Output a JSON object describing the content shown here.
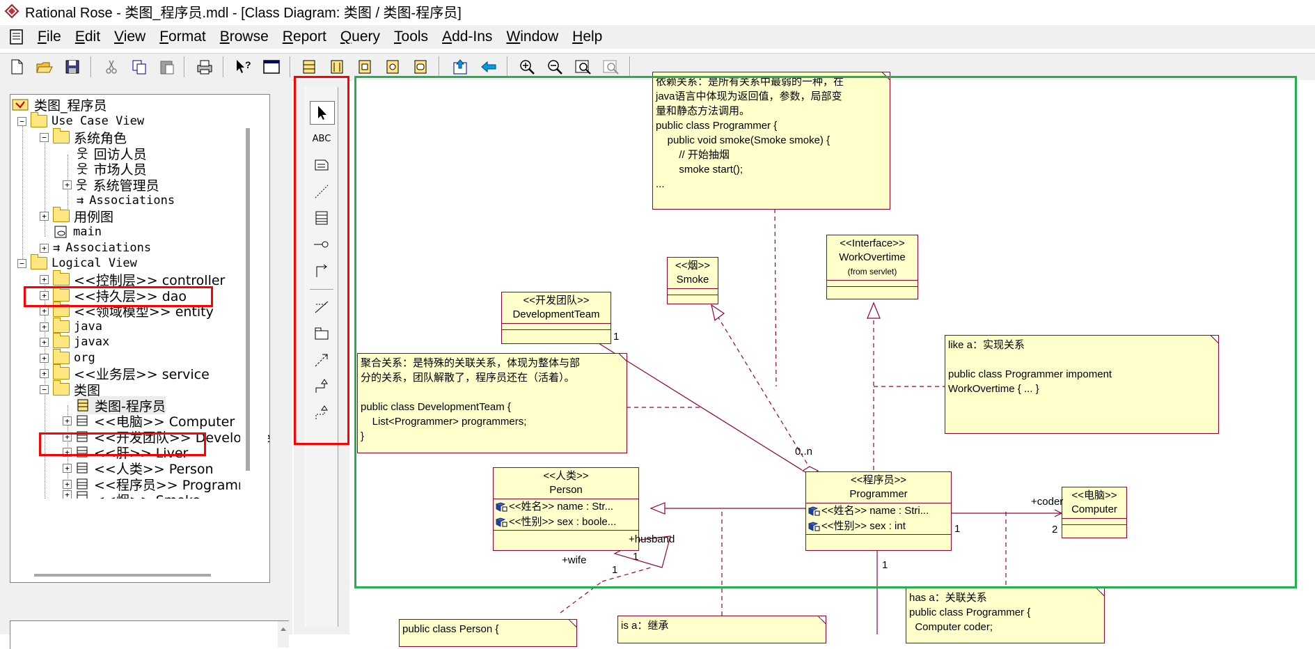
{
  "window": {
    "title": "Rational Rose - 类图_程序员.mdl - [Class Diagram: 类图 / 类图-程序员]"
  },
  "menu": [
    {
      "label": "File",
      "accel": "F",
      "rest": "ile"
    },
    {
      "label": "Edit",
      "accel": "E",
      "rest": "dit"
    },
    {
      "label": "View",
      "accel": "V",
      "rest": "iew"
    },
    {
      "label": "Format",
      "accel": "F",
      "rest": "ormat"
    },
    {
      "label": "Browse",
      "accel": "B",
      "rest": "rowse"
    },
    {
      "label": "Report",
      "accel": "R",
      "rest": "eport"
    },
    {
      "label": "Query",
      "accel": "Q",
      "rest": "uery"
    },
    {
      "label": "Tools",
      "accel": "T",
      "rest": "ools"
    },
    {
      "label": "Add-Ins",
      "accel": "A",
      "rest": "dd-Ins"
    },
    {
      "label": "Window",
      "accel": "W",
      "rest": "indow"
    },
    {
      "label": "Help",
      "accel": "H",
      "rest": "elp"
    }
  ],
  "toolbar": {
    "icons": [
      "new-file-icon",
      "open-folder-icon",
      "save-icon",
      "cut-icon",
      "copy-icon",
      "paste-icon",
      "print-icon",
      "context-help-icon",
      "view-doc-icon",
      "browse-class-icon",
      "browse-interaction-icon",
      "browse-component-icon",
      "browse-deployment-icon",
      "browse-statechart-icon",
      "browse-parent-icon",
      "browse-previous-icon",
      "zoom-in-icon",
      "zoom-out-icon",
      "fit-window-icon",
      "undo-fit-icon"
    ]
  },
  "tree": {
    "root": "类图_程序员",
    "use_case_view": "Use Case View",
    "actors_folder": "系统角色",
    "actor_1": "回访人员",
    "actor_2": "市场人员",
    "actor_3": "系统管理员",
    "associations_1": "Associations",
    "use_case_diagrams": "用例图",
    "main": "main",
    "associations_2": "Associations",
    "logical_view": "Logical View",
    "pkg_controller": "<<控制层>> controller",
    "pkg_dao": "<<持久层>> dao",
    "pkg_entity": "<<领域模型>> entity",
    "pkg_java": "java",
    "pkg_javax": "javax",
    "pkg_org": "org",
    "pkg_service": "<<业务层>> service",
    "class_diagram_folder": "类图",
    "class_diagram": "类图-程序员",
    "cls_computer": "<<电脑>> Computer",
    "cls_devteam": "<<开发团队>> Developmen",
    "cls_liver": "<<肝>> Liver",
    "cls_person": "<<人类>> Person",
    "cls_programmer": "<<程序员>> Programmer",
    "cls_smoke": "<<烟>> Smoke"
  },
  "palette": {
    "tools": [
      "selection-tool-icon",
      "text-tool-icon",
      "note-tool-icon",
      "anchor-note-tool-icon",
      "class-tool-icon",
      "interface-tool-icon",
      "unidirectional-association-icon",
      "association-class-icon",
      "package-tool-icon",
      "dependency-tool-icon",
      "generalization-tool-icon",
      "realization-tool-icon"
    ],
    "text_label": "ABC"
  },
  "diagram": {
    "note_dependency": "依赖关系：是所有关系中最弱的一种，在\njava语言中体现为返回值，参数，局部变\n量和静态方法调用。\npublic class Programmer {\n    public void smoke(Smoke smoke) {\n        // 开始抽烟\n        smoke start();\n...",
    "note_aggregation": "聚合关系：是特殊的关联关系，体现为整体与部\n分的关系，团队解散了，程序员还在（活着）。\n\npublic class DevelopmentTeam {\n    List<Programmer> programmers;\n}",
    "note_realization": "like a：实现关系\n\npublic class Programmer impoment\nWorkOvertime { ... }",
    "note_association": "has a：关联关系\npublic class Programmer {\n  Computer coder;",
    "note_person": "public class Person {",
    "note_inheritance": "is a：继承",
    "smoke": {
      "stereotype": "<<烟>>",
      "name": "Smoke"
    },
    "work_overtime": {
      "stereotype": "<<Interface>>",
      "name": "WorkOvertime",
      "sub": "(from servlet)"
    },
    "dev_team": {
      "stereotype": "<<开发团队>>",
      "name": "DevelopmentTeam"
    },
    "person": {
      "stereotype": "<<人类>>",
      "name": "Person",
      "attr1": "<<姓名>> name : Str...",
      "attr2": "<<性别>> sex : boole..."
    },
    "programmer": {
      "stereotype": "<<程序员>>",
      "name": "Programmer",
      "attr1": "<<姓名>> name : Stri...",
      "attr2": "<<性别>> sex : int"
    },
    "computer": {
      "stereotype": "<<电脑>>",
      "name": "Computer"
    },
    "labels": {
      "devteam_mult": "1",
      "prog_mult_0n": "0..n",
      "husband": "+husband",
      "wife": "+wife",
      "mult_1a": "1",
      "mult_1b": "1",
      "prog_right_1": "1",
      "coder": "+coder",
      "computer_2": "2",
      "prog_bottom_1": "1"
    }
  },
  "colors": {
    "annotation_red": "#ff0000",
    "annotation_green": "#22b14c",
    "line": "#990033",
    "fill": "#ffffcc"
  }
}
